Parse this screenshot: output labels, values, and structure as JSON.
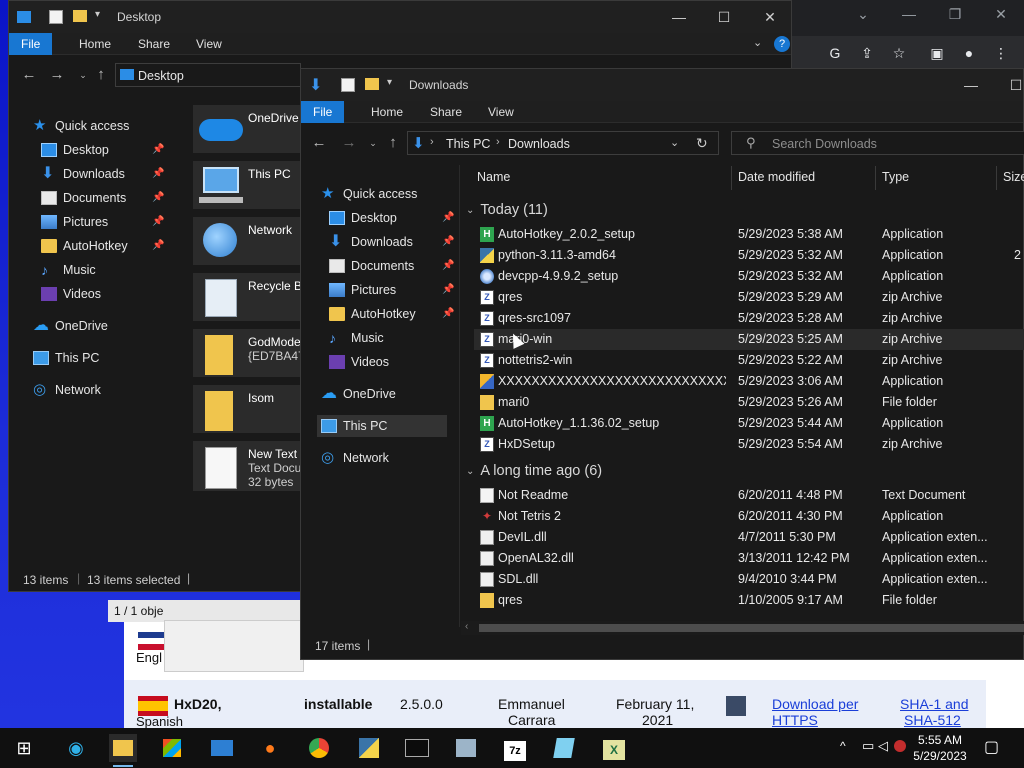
{
  "desktop_window": {
    "title": "Desktop",
    "ribbon_tabs": [
      "File",
      "Home",
      "Share",
      "View"
    ],
    "address": "Desktop",
    "sidebar": [
      {
        "label": "Quick access",
        "icon": "star-icon",
        "pinned": false
      },
      {
        "label": "Desktop",
        "icon": "desktop-icon",
        "pinned": true
      },
      {
        "label": "Downloads",
        "icon": "download-icon",
        "pinned": true
      },
      {
        "label": "Documents",
        "icon": "documents-icon",
        "pinned": true
      },
      {
        "label": "Pictures",
        "icon": "pictures-icon",
        "pinned": true
      },
      {
        "label": "AutoHotkey",
        "icon": "folder-icon",
        "pinned": true
      },
      {
        "label": "Music",
        "icon": "music-icon",
        "pinned": false
      },
      {
        "label": "Videos",
        "icon": "videos-icon",
        "pinned": false
      },
      {
        "label": "OneDrive",
        "icon": "onedrive-icon",
        "pinned": false
      },
      {
        "label": "This PC",
        "icon": "this-pc-icon",
        "pinned": false
      },
      {
        "label": "Network",
        "icon": "network-icon",
        "pinned": false
      }
    ],
    "tiles": [
      {
        "name": "OneDrive",
        "line2": "",
        "line3": ""
      },
      {
        "name": "This PC",
        "line2": "",
        "line3": ""
      },
      {
        "name": "Network",
        "line2": "",
        "line3": ""
      },
      {
        "name": "Recycle Bin",
        "line2": "",
        "line3": ""
      },
      {
        "name": "GodMode.",
        "line2": "{ED7BA470-",
        "line3": ""
      },
      {
        "name": "Isom",
        "line2": "",
        "line3": ""
      },
      {
        "name": "New Text D",
        "line2": "Text Docum",
        "line3": "32 bytes"
      }
    ],
    "status_items": "13 items",
    "status_selected": "13 items selected",
    "fragment_text": "1 / 1 obje"
  },
  "downloads_window": {
    "title": "Downloads",
    "ribbon_tabs": [
      "File",
      "Home",
      "Share",
      "View"
    ],
    "breadcrumb": [
      "This PC",
      "Downloads"
    ],
    "search_placeholder": "Search Downloads",
    "sidebar": [
      {
        "label": "Quick access",
        "icon": "star-icon",
        "pinned": false
      },
      {
        "label": "Desktop",
        "icon": "desktop-icon",
        "pinned": true
      },
      {
        "label": "Downloads",
        "icon": "download-icon",
        "pinned": true
      },
      {
        "label": "Documents",
        "icon": "documents-icon",
        "pinned": true
      },
      {
        "label": "Pictures",
        "icon": "pictures-icon",
        "pinned": true
      },
      {
        "label": "AutoHotkey",
        "icon": "folder-icon",
        "pinned": true
      },
      {
        "label": "Music",
        "icon": "music-icon",
        "pinned": false
      },
      {
        "label": "Videos",
        "icon": "videos-icon",
        "pinned": false
      },
      {
        "label": "OneDrive",
        "icon": "onedrive-icon",
        "pinned": false
      },
      {
        "label": "This PC",
        "icon": "this-pc-icon",
        "pinned": false,
        "selected": true
      },
      {
        "label": "Network",
        "icon": "network-icon",
        "pinned": false
      }
    ],
    "columns": [
      "Name",
      "Date modified",
      "Type",
      "Size"
    ],
    "groups": [
      {
        "label": "Today (11)",
        "files": [
          {
            "name": "AutoHotkey_2.0.2_setup",
            "date": "5/29/2023 5:38 AM",
            "type": "Application",
            "size": "",
            "icon": "ahk-icon"
          },
          {
            "name": "python-3.11.3-amd64",
            "date": "5/29/2023 5:32 AM",
            "type": "Application",
            "size": "2",
            "icon": "python-icon"
          },
          {
            "name": "devcpp-4.9.9.2_setup",
            "date": "5/29/2023 5:32 AM",
            "type": "Application",
            "size": "",
            "icon": "devcpp-icon"
          },
          {
            "name": "qres",
            "date": "5/29/2023 5:29 AM",
            "type": "zip Archive",
            "size": "",
            "icon": "zip-icon"
          },
          {
            "name": "qres-src1097",
            "date": "5/29/2023 5:28 AM",
            "type": "zip Archive",
            "size": "",
            "icon": "zip-icon"
          },
          {
            "name": "mari0-win",
            "date": "5/29/2023 5:25 AM",
            "type": "zip Archive",
            "size": "",
            "icon": "zip-icon",
            "hover": true
          },
          {
            "name": "nottetris2-win",
            "date": "5/29/2023 5:22 AM",
            "type": "zip Archive",
            "size": "",
            "icon": "zip-icon"
          },
          {
            "name": "XXXXXXXXXXXXXXXXXXXXXXXXXXXXXXX...",
            "date": "5/29/2023 3:06 AM",
            "type": "Application",
            "size": "",
            "icon": "app-icon"
          },
          {
            "name": "mari0",
            "date": "5/29/2023 5:26 AM",
            "type": "File folder",
            "size": "",
            "icon": "folder-icon"
          },
          {
            "name": "AutoHotkey_1.1.36.02_setup",
            "date": "5/29/2023 5:44 AM",
            "type": "Application",
            "size": "",
            "icon": "ahk-icon"
          },
          {
            "name": "HxDSetup",
            "date": "5/29/2023 5:54 AM",
            "type": "zip Archive",
            "size": "",
            "icon": "zip-icon"
          }
        ]
      },
      {
        "label": "A long time ago (6)",
        "files": [
          {
            "name": "Not Readme",
            "date": "6/20/2011 4:48 PM",
            "type": "Text Document",
            "size": "",
            "icon": "text-icon"
          },
          {
            "name": "Not Tetris 2",
            "date": "6/20/2011 4:30 PM",
            "type": "Application",
            "size": "",
            "icon": "tetris-icon"
          },
          {
            "name": "DevIL.dll",
            "date": "4/7/2011 5:30 PM",
            "type": "Application exten...",
            "size": "",
            "icon": "dll-icon"
          },
          {
            "name": "OpenAL32.dll",
            "date": "3/13/2011 12:42 PM",
            "type": "Application exten...",
            "size": "",
            "icon": "dll-icon"
          },
          {
            "name": "SDL.dll",
            "date": "9/4/2010 3:44 PM",
            "type": "Application exten...",
            "size": "",
            "icon": "dll-icon"
          },
          {
            "name": "qres",
            "date": "1/10/2005 9:17 AM",
            "type": "File folder",
            "size": "",
            "icon": "folder-icon"
          }
        ]
      }
    ],
    "status_items": "17 items"
  },
  "webpage": {
    "lang_fragment": "Engl",
    "row": {
      "name": "HxD20,",
      "name_sub": "Spanish",
      "kind": "installable",
      "version": "2.5.0.0",
      "author": "Emmanuel",
      "author_line2": "Carrara",
      "date": "February 11,",
      "date_line2": "2021",
      "download": "Download per",
      "download_line2": "HTTPS",
      "hash": "SHA-1 and",
      "hash_line2": "SHA-512"
    }
  },
  "taskbar": {
    "time": "5:55 AM",
    "date": "5/29/2023",
    "apps": [
      "start-icon",
      "edge-icon",
      "file-explorer-icon",
      "store-icon",
      "mail-icon",
      "firefox-icon",
      "chrome-icon",
      "python-icon",
      "terminal-icon",
      "app-icon",
      "7zip-icon",
      "notepad-icon",
      "excel-icon"
    ]
  },
  "colors": {
    "accent": "#1877d2",
    "window_bg": "#191919",
    "titlebar": "#202020",
    "folder": "#f0c54d"
  }
}
